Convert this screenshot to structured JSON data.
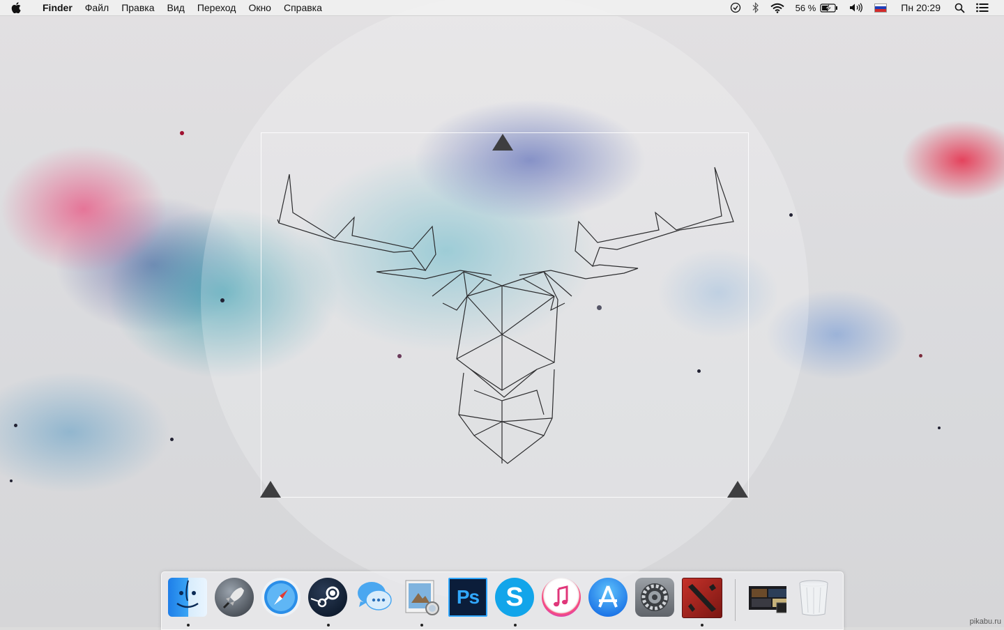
{
  "menubar": {
    "app_name": "Finder",
    "menus": [
      "Файл",
      "Правка",
      "Вид",
      "Переход",
      "Окно",
      "Справка"
    ],
    "battery_percent": "56 %",
    "clock": "Пн 20:29",
    "status_icons": [
      "timemachine-icon",
      "bluetooth-icon",
      "wifi-icon",
      "battery-charging-icon",
      "volume-icon",
      "flag-russia-icon",
      "spotlight-icon",
      "notification-center-icon"
    ]
  },
  "dock": {
    "apps": [
      {
        "name": "Finder",
        "icon": "finder-icon",
        "running": true
      },
      {
        "name": "Launchpad",
        "icon": "launchpad-icon",
        "running": false
      },
      {
        "name": "Safari",
        "icon": "safari-icon",
        "running": false
      },
      {
        "name": "Steam",
        "icon": "steam-icon",
        "running": true
      },
      {
        "name": "Messages",
        "icon": "messages-icon",
        "running": false
      },
      {
        "name": "Preview",
        "icon": "preview-icon",
        "running": true
      },
      {
        "name": "Photoshop",
        "icon": "photoshop-icon",
        "running": false
      },
      {
        "name": "Skype",
        "icon": "skype-icon",
        "running": true
      },
      {
        "name": "iTunes",
        "icon": "itunes-icon",
        "running": false
      },
      {
        "name": "App Store",
        "icon": "appstore-icon",
        "running": false
      },
      {
        "name": "System Preferences",
        "icon": "system-preferences-icon",
        "running": false
      },
      {
        "name": "Dota 2",
        "icon": "dota2-icon",
        "running": true
      },
      {
        "name": "Desktop Stack",
        "icon": "stack-icon",
        "running": false
      },
      {
        "name": "Trash",
        "icon": "trash-icon",
        "running": false
      }
    ],
    "photoshop_label": "Ps",
    "skype_label": "S"
  },
  "watermark": "pikabu.ru",
  "colors": {
    "menubar_bg": "#f0f0f0",
    "photoshop_bg": "#0b1d3a",
    "photoshop_text": "#31a8ff",
    "skype_blue": "#12a5ea",
    "dota_red": "#a8211c"
  }
}
